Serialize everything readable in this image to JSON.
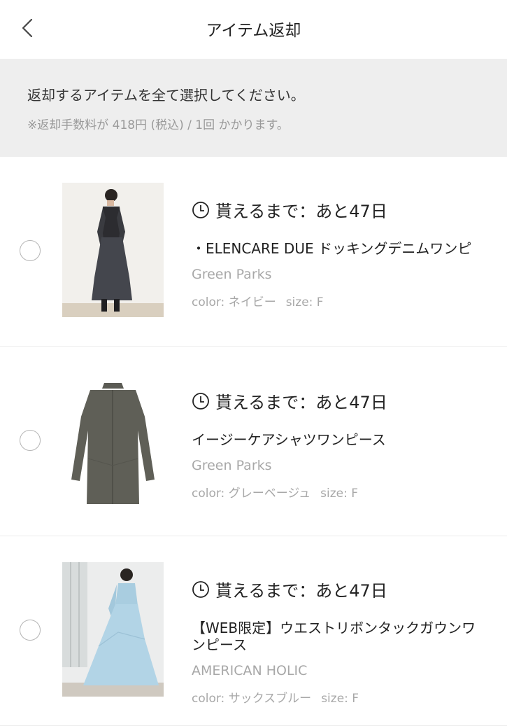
{
  "header": {
    "title": "アイテム返却",
    "back_icon": "chevron-left-icon"
  },
  "notice": {
    "main": "返却するアイテムを全て選択してください。",
    "sub": "※返却手数料が 418円 (税込) / 1回 かかります。"
  },
  "items": [
    {
      "deadline": "貰えるまで：あと47日",
      "name": "・ELENCARE DUE ドッキングデニムワンピ",
      "brand": "Green Parks",
      "color": "color: ネイビー",
      "size": "size: F",
      "selected": false
    },
    {
      "deadline": "貰えるまで：あと47日",
      "name": "イージーケアシャツワンピース",
      "brand": "Green Parks",
      "color": "color: グレーベージュ",
      "size": "size: F",
      "selected": false
    },
    {
      "deadline": "貰えるまで：あと47日",
      "name": "【WEB限定】ウエストリボンタックガウンワンピース",
      "brand": "AMERICAN HOLIC",
      "color": "color: サックスブルー",
      "size": "size: F",
      "selected": false
    }
  ],
  "colors": {
    "notice_bg": "#eeeeee",
    "muted_text": "#a8a8a8",
    "radio_border": "#b5b5b5"
  }
}
